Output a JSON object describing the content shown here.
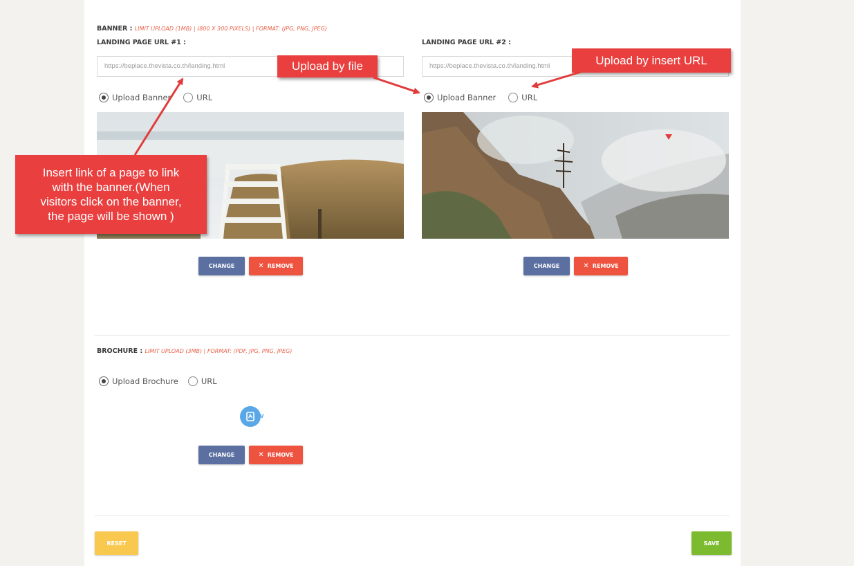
{
  "banner": {
    "title": "BANNER :",
    "note": "LIMIT UPLOAD (1MB) | (800 X 300 PIXELS) | FORMAT: (JPG, PNG, JPEG)",
    "col1": {
      "label": "LANDING PAGE URL #1 :",
      "input_value": "https://beplace.thevista.co.th/landing.html",
      "radio_upload": "Upload Banner",
      "radio_url": "URL",
      "change": "CHANGE",
      "remove": "REMOVE"
    },
    "col2": {
      "label": "LANDING PAGE URL #2 :",
      "input_value": "https://beplace.thevista.co.th/landing.html",
      "radio_upload": "Upload Banner",
      "radio_url": "URL",
      "change": "CHANGE",
      "remove": "REMOVE"
    }
  },
  "brochure": {
    "title": "BROCHURE :",
    "note": "LIMIT UPLOAD (3MB) | FORMAT: (PDF, JPG, PNG, JPEG)",
    "radio_upload": "Upload Brochure",
    "radio_url": "URL",
    "change": "CHANGE",
    "remove": "REMOVE",
    "file_icon": "pdf-file-icon"
  },
  "footer": {
    "reset": "RESET",
    "save": "SAVE"
  },
  "annotations": {
    "upload_by_file": "Upload by file",
    "upload_by_url": "Upload by insert URL",
    "insert_link": [
      "Insert link of a page to link",
      "with the banner.(When",
      "visitors click on the banner,",
      "the page will be shown )"
    ]
  },
  "colors": {
    "change_btn": "#5b6fa1",
    "remove_btn": "#ee5340",
    "reset_btn": "#f9c84f",
    "save_btn": "#7cba2f",
    "callout": "#ea3f3f"
  }
}
